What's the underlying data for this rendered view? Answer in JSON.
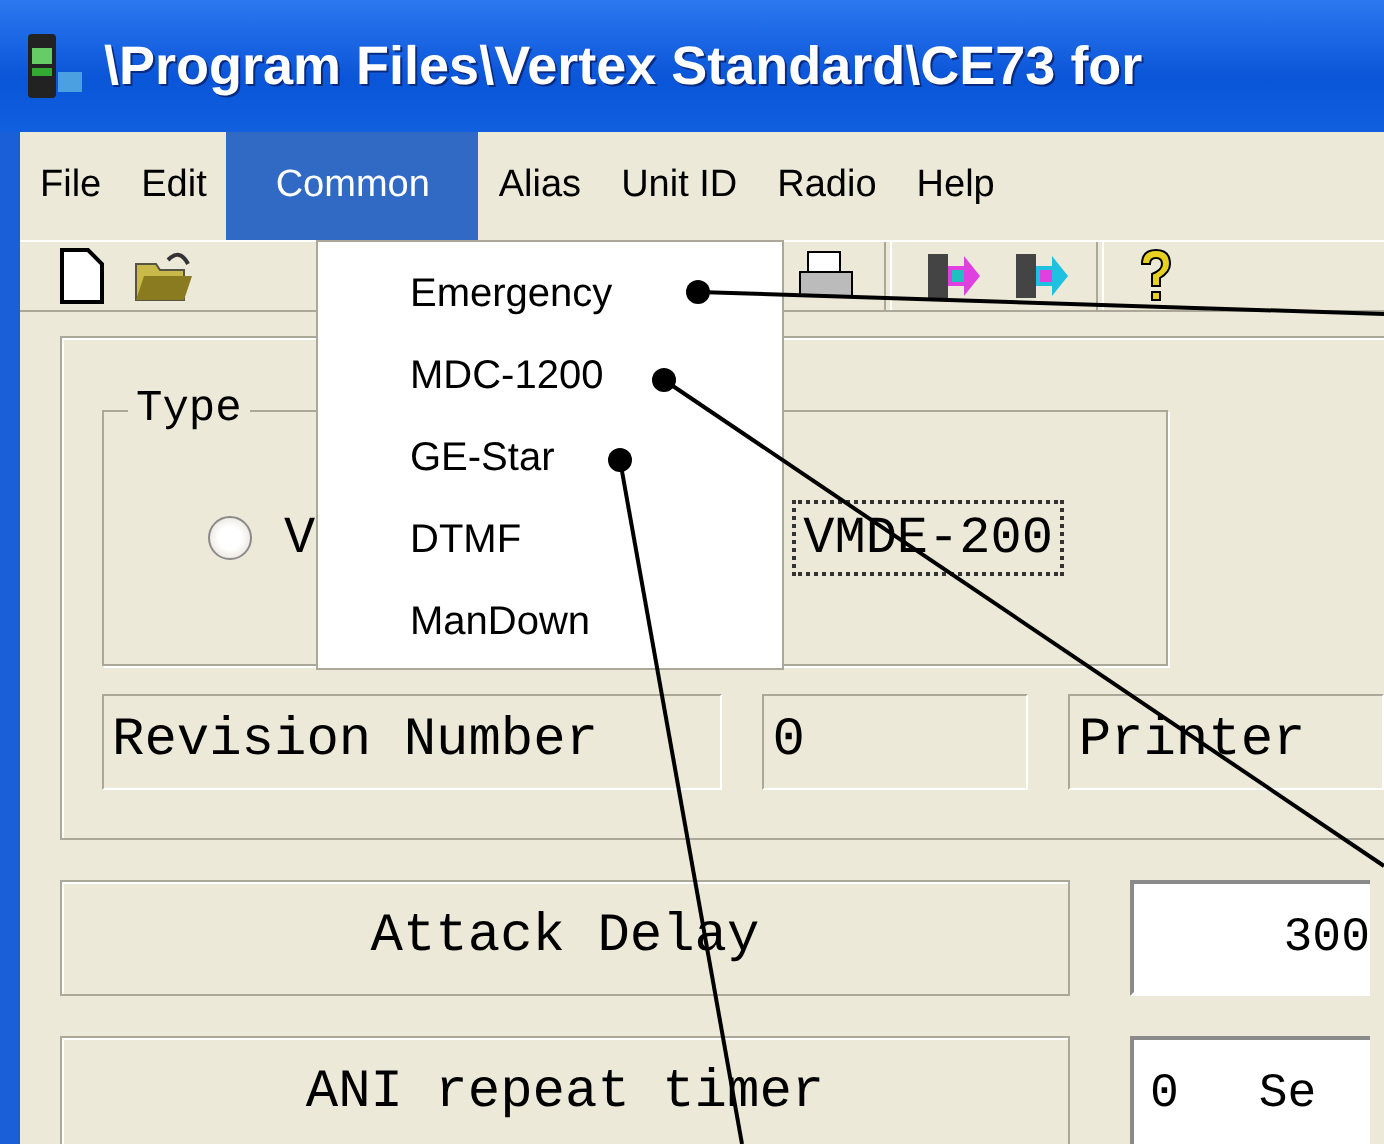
{
  "window": {
    "title": "\\Program Files\\Vertex Standard\\CE73 for"
  },
  "menu_bar": [
    {
      "label": "File",
      "selected": false
    },
    {
      "label": "Edit",
      "selected": false
    },
    {
      "label": "Common",
      "selected": true
    },
    {
      "label": "Alias",
      "selected": false
    },
    {
      "label": "Unit ID",
      "selected": false
    },
    {
      "label": "Radio",
      "selected": false
    },
    {
      "label": "Help",
      "selected": false
    }
  ],
  "dropdown": {
    "items": [
      "Emergency",
      "MDC-1200",
      "GE-Star",
      "DTMF",
      "ManDown"
    ]
  },
  "type_group": {
    "legend": "Type",
    "options": [
      {
        "label": "V",
        "focused": false,
        "selected": false
      },
      {
        "label": "VMDE-200",
        "focused": true
      }
    ]
  },
  "info_row": [
    "Revision Number",
    "0",
    "Printer"
  ],
  "settings": [
    {
      "label": "Attack Delay",
      "value": "300"
    },
    {
      "label": "ANI repeat timer",
      "value": "0",
      "unit": "Se"
    }
  ]
}
